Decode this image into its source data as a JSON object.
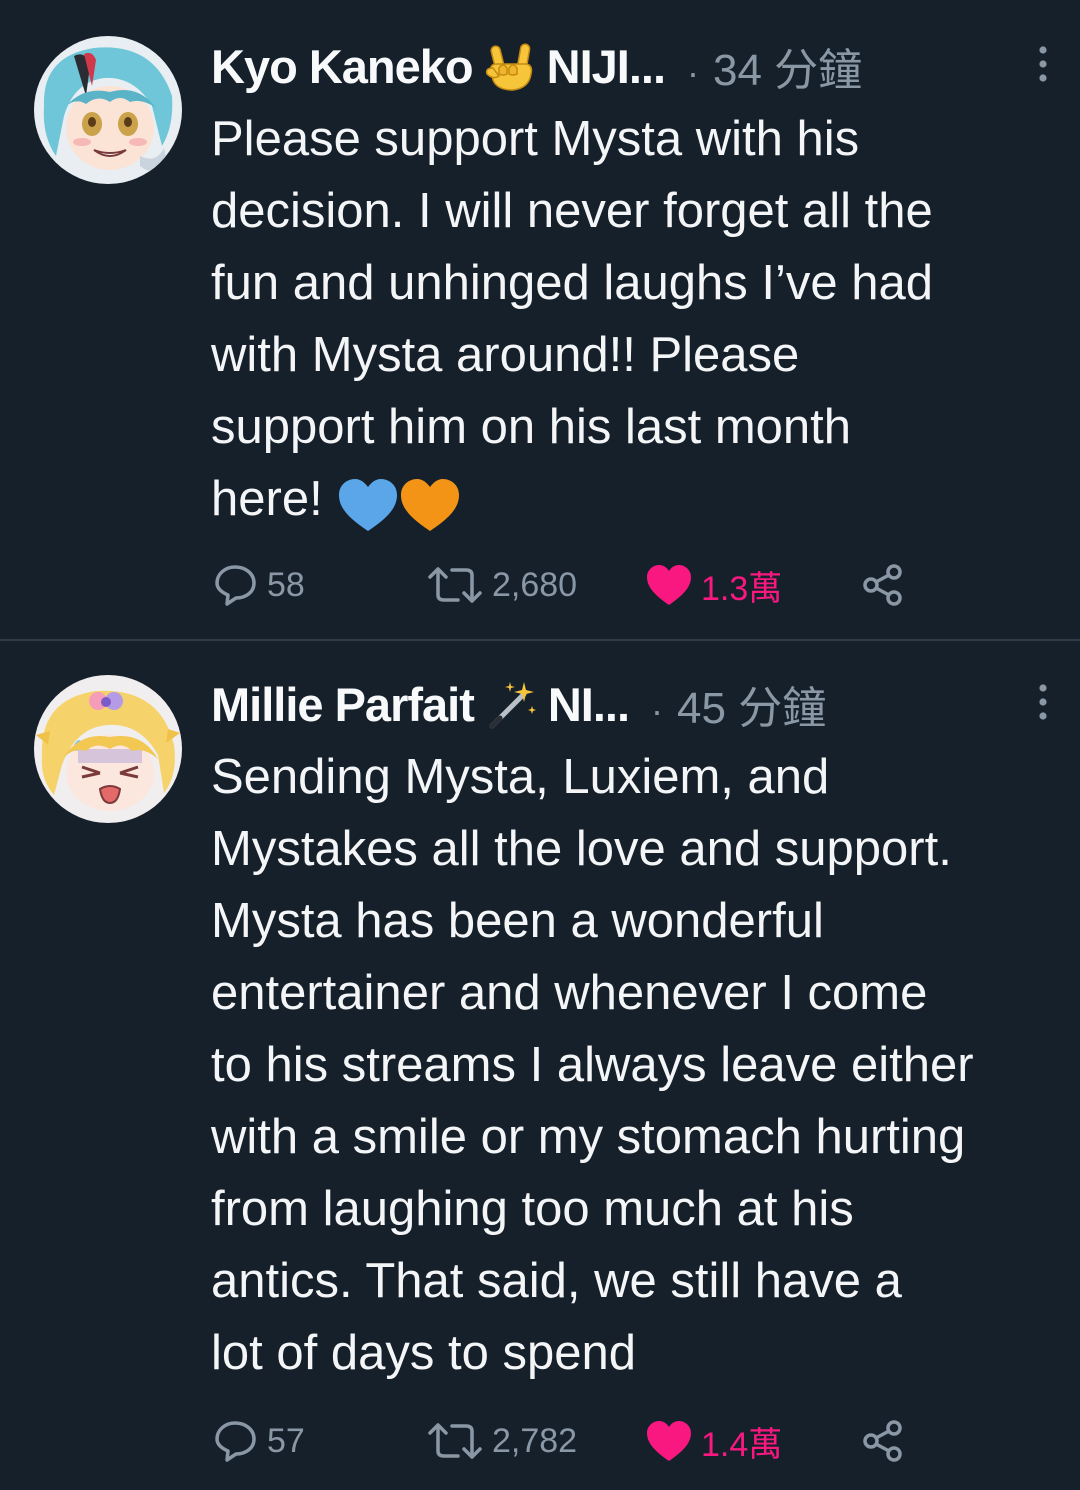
{
  "tweets": [
    {
      "author": {
        "display_name": "Kyo Kaneko",
        "name_emoji": "rock-on-hand-icon",
        "name_suffix": "NIJI...",
        "avatar": "anime-avatar-teal-hair"
      },
      "separator": "·",
      "timestamp": "34 分鐘",
      "text_lines": [
        "Please support Mysta with his",
        "decision. I will never forget all the",
        "fun and unhinged laughs I’ve had",
        "with Mysta around!! Please",
        "support him on his last month",
        "here!"
      ],
      "trailing_emojis": [
        "blue-heart-icon",
        "orange-heart-icon"
      ],
      "actions": {
        "replies": "58",
        "retweets": "2,680",
        "likes": "1.3萬",
        "liked": true
      }
    },
    {
      "author": {
        "display_name": "Millie Parfait",
        "name_emoji": "magic-wand-icon",
        "name_suffix": "NI...",
        "avatar": "anime-avatar-blonde-hair"
      },
      "separator": "·",
      "timestamp": "45 分鐘",
      "text_lines": [
        "Sending Mysta, Luxiem, and",
        "Mystakes all the love and support.",
        "Mysta has been a wonderful",
        "entertainer and whenever I come",
        "to his streams I always leave either",
        "with a smile or my stomach hurting",
        "from laughing too much at his",
        "antics. That said, we still have a",
        "lot of days to spend"
      ],
      "actions": {
        "replies": "57",
        "retweets": "2,782",
        "likes": "1.4萬",
        "liked": true
      }
    }
  ],
  "colors": {
    "background": "#16202b",
    "text": "#f3f5f7",
    "muted": "#8a98a6",
    "like": "#f91880",
    "divider": "#2f3b47"
  }
}
